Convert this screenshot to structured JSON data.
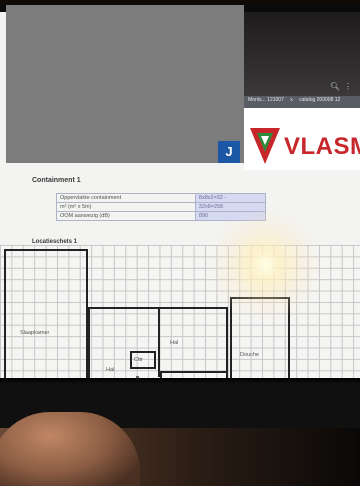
{
  "browser": {
    "tab_items": [
      "Monts...  121007",
      "x",
      "catalog  200008  12"
    ]
  },
  "brand": {
    "logo_text": "VLASMA",
    "colors": {
      "red": "#c7272b",
      "green": "#2d8a3a"
    }
  },
  "redaction": {
    "badge_letter": "J"
  },
  "document": {
    "section_title": "Containment 1",
    "rows": [
      {
        "label": "Oppervlakte containment",
        "value": "8x8x2=32   -"
      },
      {
        "label": "m² (m² x 5m)",
        "value": "32x8=256"
      },
      {
        "label": "OOM aanwezig (dB)",
        "value": "890"
      }
    ],
    "subsection_title": "Locatieschets 1"
  },
  "floorplan": {
    "labels": {
      "room_a": "Slaapkamer",
      "room_b": "Hal",
      "room_c": "Hal",
      "room_d": "Douche",
      "box": "Cttr"
    }
  }
}
